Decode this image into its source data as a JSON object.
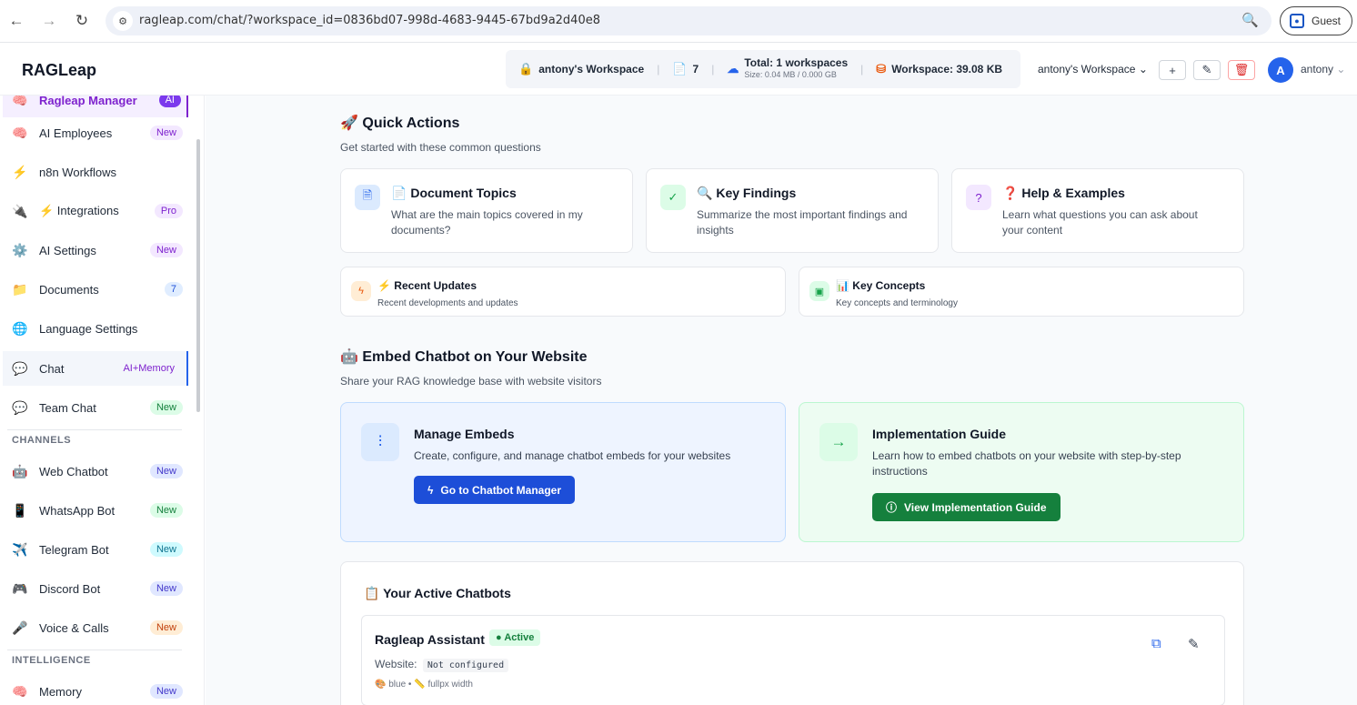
{
  "browser": {
    "url": "ragleap.com/chat/?workspace_id=0836bd07-998d-4683-9445-67bd9a2d40e8",
    "guest_label": "Guest"
  },
  "header": {
    "brand": "RAGLeap",
    "workspace_name": "antony's Workspace",
    "doc_count": "7",
    "total_label": "Total: 1 workspaces",
    "size_label": "Size: 0.04 MB / 0.000 GB",
    "workspace_size": "Workspace: 39.08 KB",
    "workspace_dropdown": "antony's Workspace",
    "avatar_letter": "A",
    "username": "antony"
  },
  "sidebar": {
    "partial_item": "Ragleap Manager",
    "items": [
      {
        "label": "AI Employees",
        "badge": "New",
        "icon": "🧠"
      },
      {
        "label": "n8n Workflows",
        "badge": "",
        "icon": "⚡"
      },
      {
        "label": "⚡ Integrations",
        "badge": "Pro",
        "icon": "🔌"
      },
      {
        "label": "AI Settings",
        "badge": "New",
        "icon": "⚙️"
      },
      {
        "label": "Documents",
        "badge": "7",
        "icon": "📁"
      },
      {
        "label": "Language Settings",
        "badge": "",
        "icon": "🌐"
      },
      {
        "label": "Chat",
        "badge": "AI+Memory",
        "icon": "💬"
      },
      {
        "label": "Team Chat",
        "badge": "New",
        "icon": "💬"
      }
    ],
    "channels_heading": "CHANNELS",
    "channels": [
      {
        "label": "Web Chatbot",
        "badge": "New",
        "icon": "🤖"
      },
      {
        "label": "WhatsApp Bot",
        "badge": "New",
        "icon": "📱"
      },
      {
        "label": "Telegram Bot",
        "badge": "New",
        "icon": "✈️"
      },
      {
        "label": "Discord Bot",
        "badge": "New",
        "icon": "🎮"
      },
      {
        "label": "Voice & Calls",
        "badge": "New",
        "icon": "🎤"
      }
    ],
    "intelligence_heading": "INTELLIGENCE",
    "intelligence": [
      {
        "label": "Memory",
        "badge": "New",
        "icon": "🧠"
      }
    ]
  },
  "quick_actions": {
    "title": "Quick Actions",
    "subtitle": "Get started with these common questions",
    "cards": [
      {
        "title": "Document Topics",
        "title_emoji": "📄",
        "desc": "What are the main topics covered in my documents?"
      },
      {
        "title": "Key Findings",
        "title_emoji": "🔍",
        "desc": "Summarize the most important findings and insights"
      },
      {
        "title": "Help & Examples",
        "title_emoji": "❓",
        "desc": "Learn what questions you can ask about your content"
      }
    ],
    "small_cards": [
      {
        "title": "Recent Updates",
        "title_emoji": "⚡",
        "desc": "Recent developments and updates"
      },
      {
        "title": "Key Concepts",
        "title_emoji": "📊",
        "desc": "Key concepts and terminology"
      }
    ]
  },
  "embed": {
    "title": "Embed Chatbot on Your Website",
    "subtitle": "Share your RAG knowledge base with website visitors",
    "manage": {
      "title": "Manage Embeds",
      "desc": "Create, configure, and manage chatbot embeds for your websites",
      "button": "Go to Chatbot Manager"
    },
    "guide": {
      "title": "Implementation Guide",
      "desc": "Learn how to embed chatbots on your website with step-by-step instructions",
      "button": "View Implementation Guide"
    }
  },
  "active_chatbots": {
    "title": "Your Active Chatbots",
    "bot": {
      "name": "Ragleap Assistant",
      "status": "Active",
      "website_label": "Website:",
      "website_value": "Not configured",
      "color": "blue",
      "width": "fullpx width"
    }
  },
  "colors": {
    "primary": "#2563eb",
    "success": "#16a34a"
  }
}
